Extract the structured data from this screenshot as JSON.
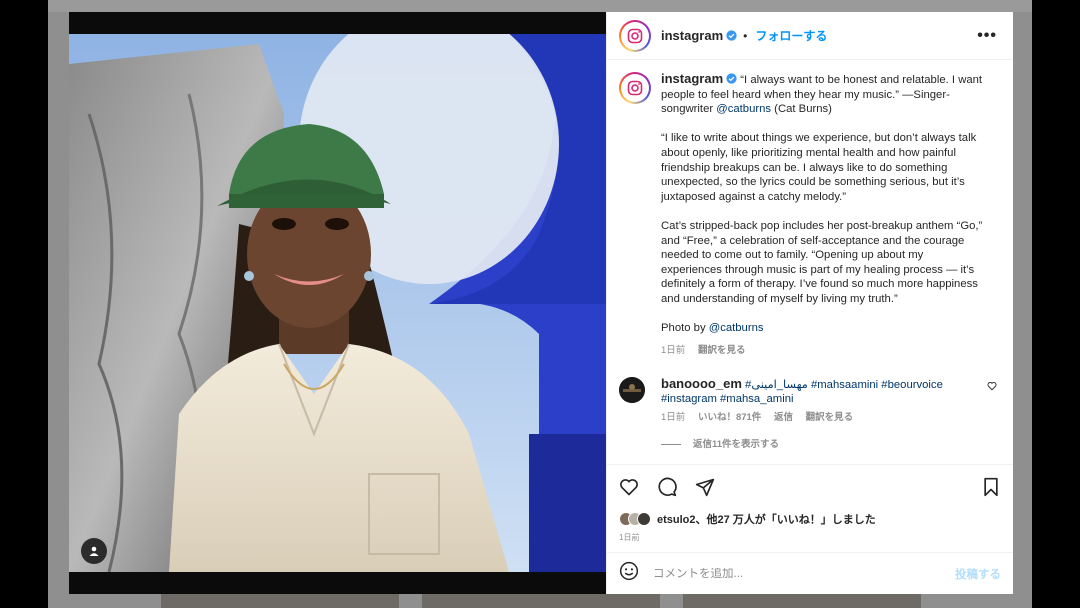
{
  "post": {
    "username": "instagram",
    "follow_label": "フォローする",
    "dot": "•",
    "more": "•••"
  },
  "caption": {
    "username": "instagram",
    "p1": "“I always want to be honest and relatable. I want people to feel heard when they hear my music.” —Singer-songwriter ",
    "p1_mention": "@catburns",
    "p1_tail": " (Cat Burns)",
    "p2": "“I like to write about things we experience, but don’t always talk about openly, like prioritizing mental health and how painful friendship breakups can be. I always like to do something unexpected, so the lyrics could be something serious, but it’s juxtaposed against a catchy melody.”",
    "p3": "Cat’s stripped-back pop includes her post-breakup anthem “Go,” and “Free,” a celebration of self-acceptance and the courage needed to come out to family. “Opening up about my experiences through music is part of my healing process — it’s definitely a form of therapy. I’ve found so much more happiness and understanding of myself by living my truth.”",
    "photo_by": "Photo by ",
    "photo_by_mention": "@catburns",
    "time": "1日前",
    "translate": "翻訳を見る"
  },
  "comment": {
    "username": "banoooo_em",
    "text": "#مهسا_امینی #mahsaamini #beourvoice #instagram #mahsa_amini",
    "time": "1日前",
    "likes": "いいね！871件",
    "reply": "返信",
    "translate": "翻訳を見る",
    "view_replies": "返信11件を表示する"
  },
  "likes": {
    "username": "etsulo2",
    "text": "、他27 万人が「いいね！」しました"
  },
  "post_time": "1日前",
  "comment_box": {
    "placeholder": "コメントを追加...",
    "post_label": "投稿する"
  },
  "icons": {
    "heart": "heart-icon",
    "comment": "comment-icon",
    "share": "paper-plane-icon",
    "bookmark": "bookmark-icon",
    "emoji": "emoji-icon",
    "verified": "verified-badge-icon",
    "user_tag": "user-tag-icon"
  },
  "colors": {
    "link_blue": "#0095f6",
    "mention": "#00376b",
    "post_disabled": "#b2dffc"
  }
}
